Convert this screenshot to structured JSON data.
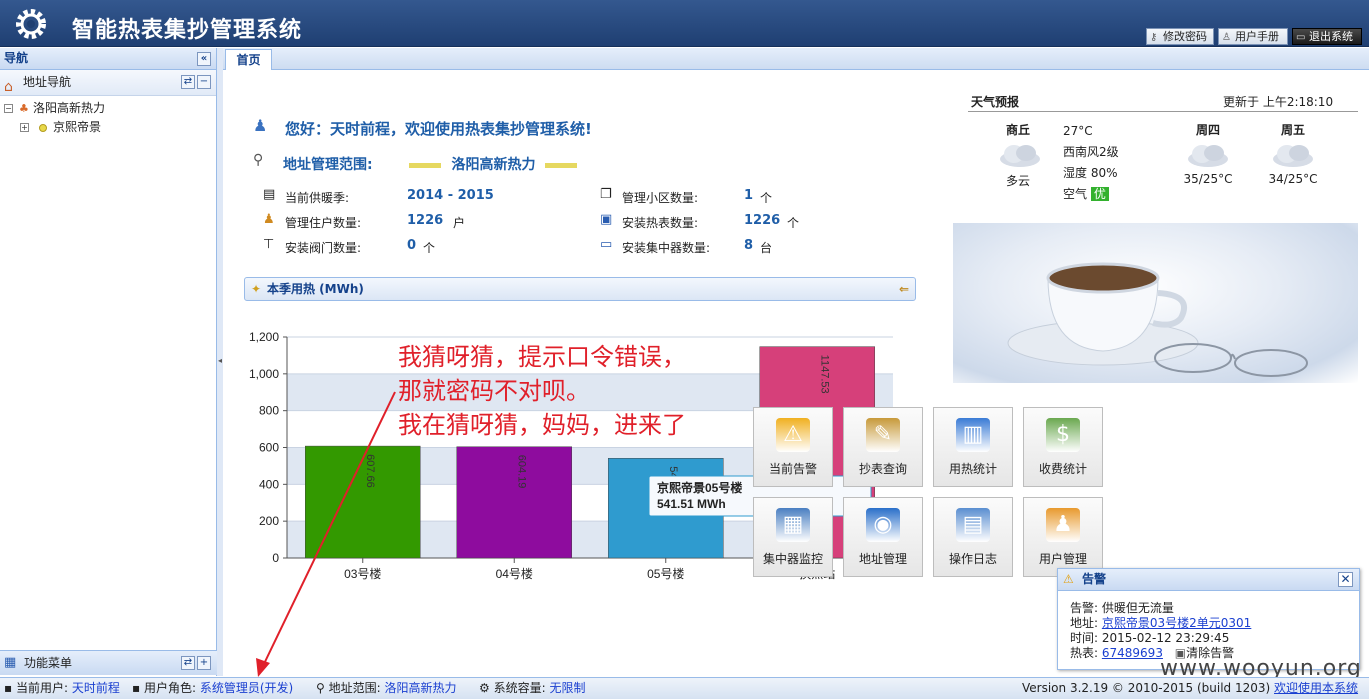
{
  "app": {
    "title": "智能热表集抄管理系统",
    "header_buttons": [
      {
        "label": "修改密码",
        "icon": "key-icon"
      },
      {
        "label": "用户手册",
        "icon": "user-icon"
      },
      {
        "label": "退出系统",
        "icon": "exit-icon"
      }
    ]
  },
  "nav": {
    "title": "导航",
    "collapse_icon": "double-left-chevron-icon",
    "section": "地址导航",
    "tree": [
      {
        "label": "洛阳高新热力",
        "expanded": true
      },
      {
        "label": "京熙帝景",
        "expanded": false
      }
    ],
    "footer": "功能菜单"
  },
  "tabs": [
    {
      "label": "首页",
      "active": true
    }
  ],
  "welcome": {
    "text": "您好：天时前程，欢迎使用热表集抄管理系统!",
    "scope_label": "地址管理范围:",
    "scope_value": "洛阳高新热力"
  },
  "stats": [
    {
      "label": "当前供暖季:",
      "value": "2014 - 2015",
      "unit": "",
      "icon": "calendar-icon"
    },
    {
      "label": "管理小区数量:",
      "value": "1",
      "unit": "个",
      "icon": "buildings-icon"
    },
    {
      "label": "管理住户数量:",
      "value": "1226",
      "unit": "户",
      "icon": "users-icon"
    },
    {
      "label": "安装热表数量:",
      "value": "1226",
      "unit": "个",
      "icon": "meter-icon"
    },
    {
      "label": "安装阀门数量:",
      "value": "0",
      "unit": "个",
      "icon": "valve-icon"
    },
    {
      "label": "安装集中器数量:",
      "value": "8",
      "unit": "台",
      "icon": "concentrator-icon"
    }
  ],
  "section": {
    "title": "本季用热 (MWh)"
  },
  "chart_data": {
    "type": "bar",
    "categories": [
      "03号楼",
      "04号楼",
      "05号楼",
      "换热站"
    ],
    "values": [
      607.66,
      604.19,
      541.51,
      1147.53
    ],
    "value_labels": [
      "607.66",
      "604.19",
      "541.51",
      "1147.53"
    ],
    "colors": [
      "#339900",
      "#8e0c9e",
      "#2f9bcf",
      "#d6407a"
    ],
    "ylim": [
      0,
      1200
    ],
    "yticks": [
      "0",
      "200",
      "400",
      "600",
      "800",
      "1,000",
      "1,200"
    ],
    "tooltip": {
      "title": "京熙帝景05号楼",
      "value": "541.51 MWh"
    }
  },
  "weather": {
    "title": "天气预报",
    "updated": "更新于 上午2:18:10",
    "days": [
      {
        "name": "商丘",
        "desc": "多云"
      },
      {
        "name": "周四",
        "desc": "35/25°C"
      },
      {
        "name": "周五",
        "desc": "34/25°C"
      }
    ],
    "temp": "27°C",
    "wind": "西南风2级",
    "humidity": "湿度 80%",
    "air_label": "空气",
    "air_value": "优"
  },
  "grid": [
    {
      "label": "当前告警",
      "icon": "warning-icon",
      "color": "#f0b020"
    },
    {
      "label": "抄表查询",
      "icon": "pencil-ruler-icon",
      "color": "#c79a3a"
    },
    {
      "label": "用热统计",
      "icon": "bar-chart-icon",
      "color": "#3a7bd5"
    },
    {
      "label": "收费统计",
      "icon": "money-icon",
      "color": "#6aa84f"
    },
    {
      "label": "集中器监控",
      "icon": "calculator-icon",
      "color": "#4a7fc1"
    },
    {
      "label": "地址管理",
      "icon": "globe-icon",
      "color": "#2a6fc9"
    },
    {
      "label": "操作日志",
      "icon": "log-book-icon",
      "color": "#5a8ed0"
    },
    {
      "label": "用户管理",
      "icon": "user-group-icon",
      "color": "#e89a2e"
    }
  ],
  "alarm": {
    "title": "告警",
    "rows": [
      {
        "label": "告警:",
        "value": "供暖但无流量"
      },
      {
        "label": "地址:",
        "value": "京熙帝景03号楼2单元0301"
      },
      {
        "label": "时间:",
        "value": "2015-02-12 23:29:45"
      },
      {
        "label": "热表:",
        "value": "67489693"
      }
    ],
    "clear": "清除告警"
  },
  "annotation": [
    "我猜呀猜，提示口令错误，",
    "那就密码不对呗。",
    "我在猜呀猜，妈妈，进来了"
  ],
  "watermark": "www.wooyun.org",
  "status": {
    "user_label": "当前用户:",
    "user": "天时前程",
    "role_label": "用户角色:",
    "role": "系统管理员(开发)",
    "scope_label": "地址范围:",
    "scope": "洛阳高新热力",
    "cap_label": "系统容量:",
    "cap": "无限制",
    "version": "Version 3.2.19 © 2010-2015 (build 1203)",
    "welcome": "欢迎使用本系统"
  }
}
